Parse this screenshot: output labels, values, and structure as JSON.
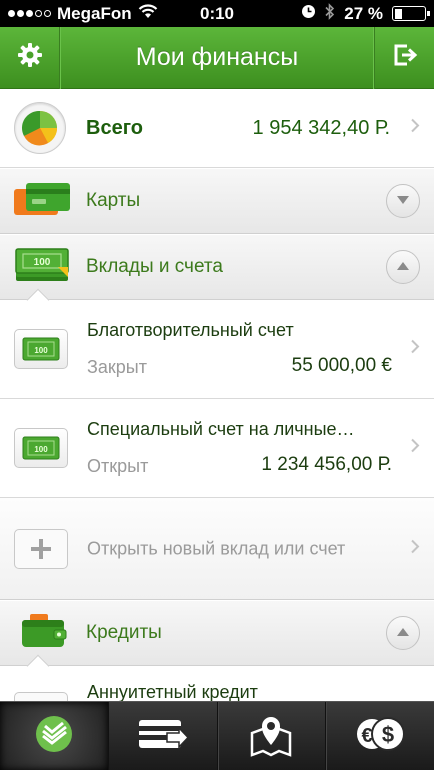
{
  "status_bar": {
    "carrier": "MegaFon",
    "time": "0:10",
    "battery": "27 %"
  },
  "header": {
    "title": "Мои финансы",
    "left_icon": "gear-icon",
    "right_icon": "logout-icon"
  },
  "total": {
    "label": "Всего",
    "value": "1 954 342,40 Р."
  },
  "sections": {
    "cards": {
      "label": "Карты",
      "state": "collapsed"
    },
    "deposits": {
      "label": "Вклады и счета",
      "state": "expanded"
    },
    "credits": {
      "label": "Кредиты",
      "state": "expanded"
    }
  },
  "accounts": [
    {
      "name": "Благотворительный счет",
      "status": "Закрыт",
      "amount": "55 000,00 €"
    },
    {
      "name": "Специальный счет на личные…",
      "status": "Открыт",
      "amount": "1 234 456,00 Р."
    }
  ],
  "new_account": {
    "label": "Открыть новый вклад или счет"
  },
  "credit_item": {
    "name": "Аннуитетный кредит"
  },
  "tabs": [
    {
      "icon": "sberbank-logo-icon",
      "active": true
    },
    {
      "icon": "card-transfer-icon",
      "active": false
    },
    {
      "icon": "map-pin-icon",
      "active": false
    },
    {
      "icon": "currency-exchange-icon",
      "active": false
    }
  ],
  "colors": {
    "brand_green": "#4aa22a",
    "text_green": "#1d5e0d",
    "tabbar": "#2a2a2a"
  }
}
